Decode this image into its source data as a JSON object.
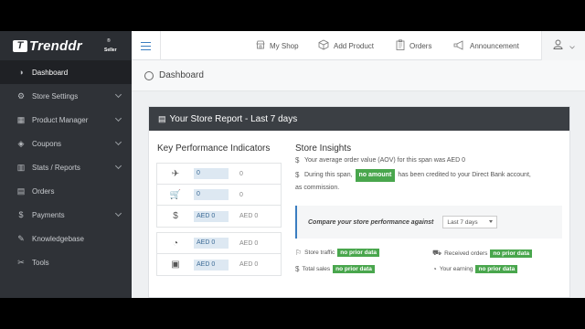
{
  "brand": {
    "mark": "T",
    "name": "Trenddr",
    "reg": "®",
    "sub": "Seller"
  },
  "sidebar": {
    "items": [
      {
        "label": "Dashboard",
        "icon": "dashboard-icon",
        "glyph": "◑",
        "active": true,
        "chevron": false
      },
      {
        "label": "Store Settings",
        "icon": "gear-icon",
        "glyph": "⚙",
        "active": false,
        "chevron": true
      },
      {
        "label": "Product Manager",
        "icon": "box-icon",
        "glyph": "▦",
        "active": false,
        "chevron": true
      },
      {
        "label": "Coupons",
        "icon": "tag-icon",
        "glyph": "◈",
        "active": false,
        "chevron": true
      },
      {
        "label": "Stats / Reports",
        "icon": "chart-icon",
        "glyph": "▥",
        "active": false,
        "chevron": true
      },
      {
        "label": "Orders",
        "icon": "orders-icon",
        "glyph": "▤",
        "active": false,
        "chevron": false
      },
      {
        "label": "Payments",
        "icon": "payments-icon",
        "glyph": "$",
        "active": false,
        "chevron": true
      },
      {
        "label": "Knowledgebase",
        "icon": "knowledgebase-icon",
        "glyph": "✎",
        "active": false,
        "chevron": false
      },
      {
        "label": "Tools",
        "icon": "wrench-icon",
        "glyph": "✂",
        "active": false,
        "chevron": false
      }
    ]
  },
  "topbar": {
    "my_shop": "My Shop",
    "add_product": "Add Product",
    "orders": "Orders",
    "announcement": "Announcement"
  },
  "breadcrumb": {
    "title": "Dashboard"
  },
  "report": {
    "title": "Your Store Report - Last 7 days",
    "kpi_title": "Key Performance Indicators",
    "kpi_rows": [
      {
        "icon": "rocket-icon",
        "glyph": "✈",
        "value": "0",
        "previous": "0"
      },
      {
        "icon": "cart-icon",
        "glyph": "🛒",
        "value": "0",
        "previous": "0"
      },
      {
        "icon": "money-bag-icon",
        "glyph": "$",
        "value": "AED 0",
        "previous": "AED 0"
      },
      {
        "icon": "piggy-bank-icon",
        "glyph": "◔",
        "value": "AED 0",
        "previous": "AED 0"
      },
      {
        "icon": "cash-register-icon",
        "glyph": "▣",
        "value": "AED 0",
        "previous": "AED 0"
      }
    ],
    "insights_title": "Store Insights",
    "aov_line": "Your average order value (AOV) for this span was AED 0",
    "credit_pre": "During this span,",
    "credit_pill": "no amount",
    "credit_post": "has been credited to your Direct Bank account,",
    "credit_post2": "as commission.",
    "compare_label": "Compare your store performance against",
    "compare_select": "Last 7 days",
    "stats": [
      {
        "label": "Store traffic",
        "pill": "no prior data",
        "icon": "traffic-icon",
        "glyph": "⚐"
      },
      {
        "label": "Received orders",
        "pill": "no prior data",
        "icon": "truck-icon",
        "glyph": "⛟"
      },
      {
        "label": "Total sales",
        "pill": "no prior data",
        "icon": "sales-icon",
        "glyph": "$"
      },
      {
        "label": "Your earning",
        "pill": "no prior data",
        "icon": "earning-icon",
        "glyph": "◔"
      }
    ]
  },
  "colors": {
    "accent": "#3a7dc0",
    "sidebar": "#2f3237",
    "header": "#3b3f44",
    "success": "#49a64d"
  }
}
